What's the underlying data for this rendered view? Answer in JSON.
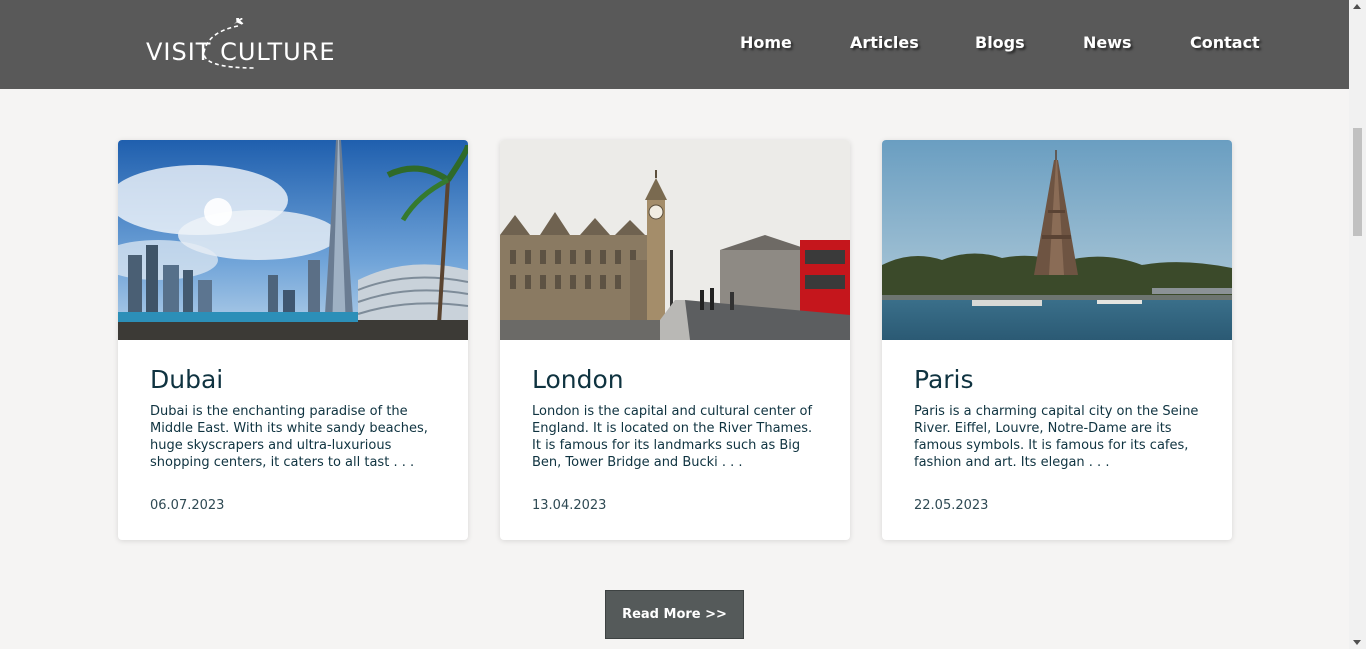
{
  "header": {
    "logo_text": "VISIT CULTURE",
    "nav": [
      "Home",
      "Articles",
      "Blogs",
      "News",
      "Contact"
    ]
  },
  "cards": [
    {
      "title": "Dubai",
      "description": "Dubai is the enchanting paradise of the Middle East. With its white sandy beaches, huge skyscrapers and ultra-luxurious shopping centers, it caters to all tast . . .",
      "date": "06.07.2023",
      "image": "dubai-skyline-image"
    },
    {
      "title": "London",
      "description": "London is the capital and cultural center of England. It is located on the River Thames. It is famous for its landmarks such as Big Ben, Tower Bridge and Bucki . . .",
      "date": "13.04.2023",
      "image": "london-big-ben-image"
    },
    {
      "title": "Paris",
      "description": "Paris is a charming capital city on the Seine River. Eiffel, Louvre, Notre-Dame are its famous symbols. It is famous for its cafes, fashion and art. Its elegan . . .",
      "date": "22.05.2023",
      "image": "paris-eiffel-tower-image"
    }
  ],
  "read_more_label": "Read More >>",
  "colors": {
    "header_bg": "#595959",
    "page_bg": "#f5f4f3",
    "title_color": "#0f3340",
    "button_bg": "#555a5a"
  }
}
